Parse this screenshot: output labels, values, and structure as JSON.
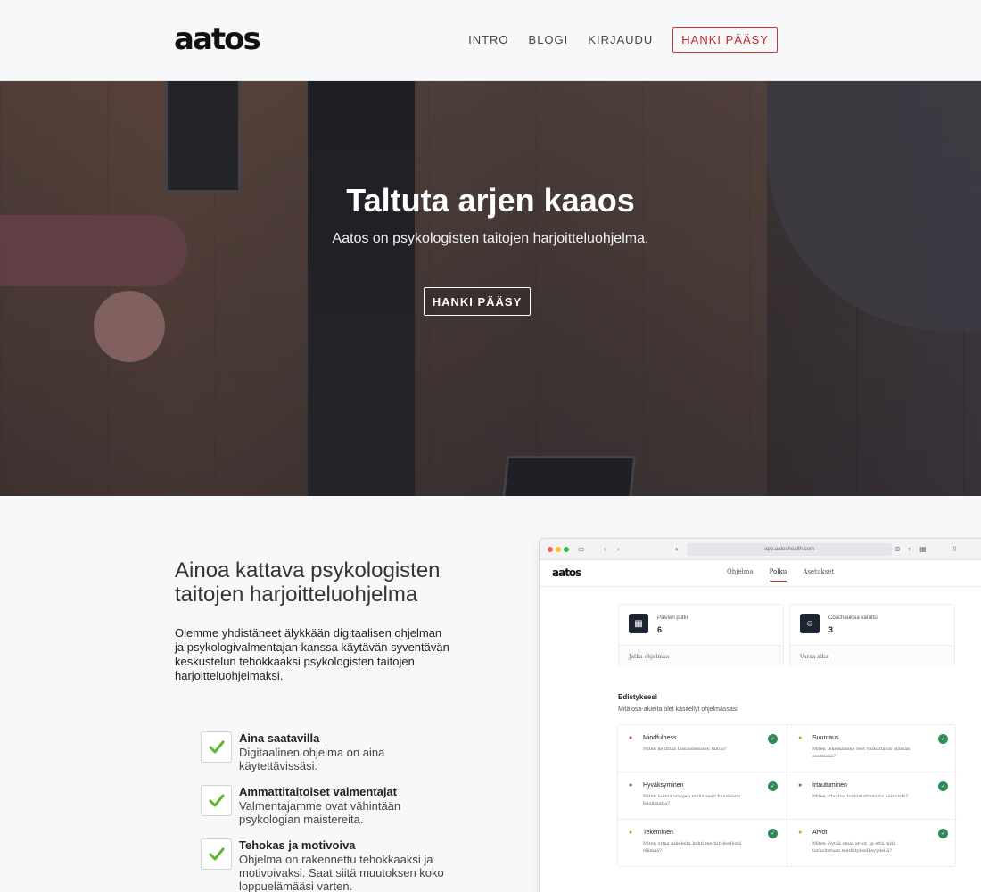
{
  "header": {
    "logo": "aatos",
    "nav": [
      "INTRO",
      "BLOGI",
      "KIRJAUDU"
    ],
    "cta": "HANKI PÄÄSY"
  },
  "hero": {
    "title": "Taltuta arjen kaaos",
    "subtitle": "Aatos on psykologisten taitojen harjoitteluohjelma.",
    "button": "HANKI PÄÄSY"
  },
  "section": {
    "title": "Ainoa kattava psykologisten taitojen harjoitteluohjelma",
    "text": "Olemme yhdistäneet älykkään digitaalisen ohjelman ja psykologivalmentajan kanssa käytävän syventävän keskustelun tehokkaaksi psykologisten taitojen harjoitteluohjelmaksi.",
    "features": [
      {
        "title": "Aina saatavilla",
        "desc": "Digitaalinen ohjelma on aina käytettävissäsi."
      },
      {
        "title": "Ammattitaitoiset valmentajat",
        "desc": "Valmentajamme ovat vähintään psykologian maistereita."
      },
      {
        "title": "Tehokas ja motivoiva",
        "desc": "Ohjelma on rakennettu tehokkaaksi ja motivoivaksi. Saat siitä muutoksen koko loppuelämääsi varten."
      }
    ]
  },
  "app": {
    "url": "app.aatoshealth.com",
    "logo": "aatos",
    "tabs": [
      "Ohjelma",
      "Polku",
      "Asetukset"
    ],
    "active_tab": "Polku",
    "stats": [
      {
        "label": "Päivien putki",
        "value": "6",
        "footer": "Jatka ohjelmaa"
      },
      {
        "label": "Coachauksia varattu",
        "value": "3",
        "footer": "Varaa aika"
      }
    ],
    "progress_title": "Edistyksesi",
    "progress_subtitle": "Mitä osa-alueita olet käsitellyt ohjelmassasi",
    "areas": [
      {
        "title": "Mindfulness",
        "desc": "Miten kehittää läsnäolemisen taitoa?"
      },
      {
        "title": "Suuntaus",
        "desc": "Miten tekemämme teot vaikuttavat elämän suuntaan?"
      },
      {
        "title": "Hyväksyminen",
        "desc": "Miten toimia arvojen mukaisesti haasteista huolimatta?"
      },
      {
        "title": "Irtautuminen",
        "desc": "Miten irtautua toimimattomista keinoista?"
      },
      {
        "title": "Tekeminen",
        "desc": "Miten ottaa askeleita kohti merkityksellistä elämää?"
      },
      {
        "title": "Arvot",
        "desc": "Miten löytää omat arvot, ja että mitä tarkoitetaan merkityksellisyydellä?"
      }
    ]
  }
}
